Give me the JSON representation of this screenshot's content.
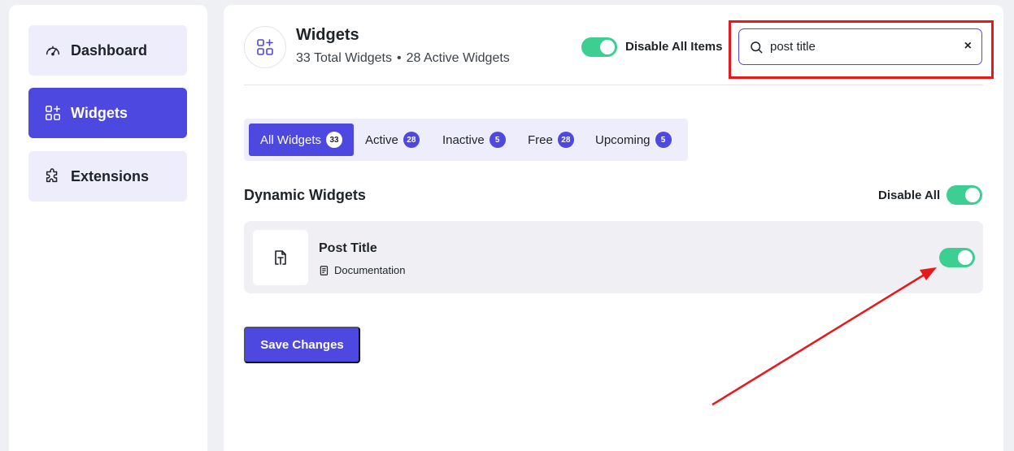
{
  "sidebar": {
    "items": [
      {
        "label": "Dashboard",
        "icon": "dashboard-gauge-icon",
        "active": false
      },
      {
        "label": "Widgets",
        "icon": "widgets-grid-icon",
        "active": true
      },
      {
        "label": "Extensions",
        "icon": "puzzle-icon",
        "active": false
      }
    ]
  },
  "header": {
    "title": "Widgets",
    "total_widgets": "33 Total Widgets",
    "separator": "•",
    "active_widgets": "28 Active Widgets",
    "disable_all_items_label": "Disable All Items"
  },
  "search": {
    "value": "post title",
    "clear_label": "×"
  },
  "tabs": [
    {
      "label": "All Widgets",
      "count": "33",
      "active": true
    },
    {
      "label": "Active",
      "count": "28",
      "active": false
    },
    {
      "label": "Inactive",
      "count": "5",
      "active": false
    },
    {
      "label": "Free",
      "count": "28",
      "active": false
    },
    {
      "label": "Upcoming",
      "count": "5",
      "active": false
    }
  ],
  "section": {
    "title": "Dynamic Widgets",
    "disable_all_label": "Disable All"
  },
  "widgets": [
    {
      "name": "Post Title",
      "doc_label": "Documentation",
      "enabled": true
    }
  ],
  "save_button": "Save Changes",
  "colors": {
    "accent": "#4d48e0",
    "accent_light": "#eeedfb",
    "toggle_on": "#3ccf91",
    "annotation_red": "#e8191d"
  }
}
